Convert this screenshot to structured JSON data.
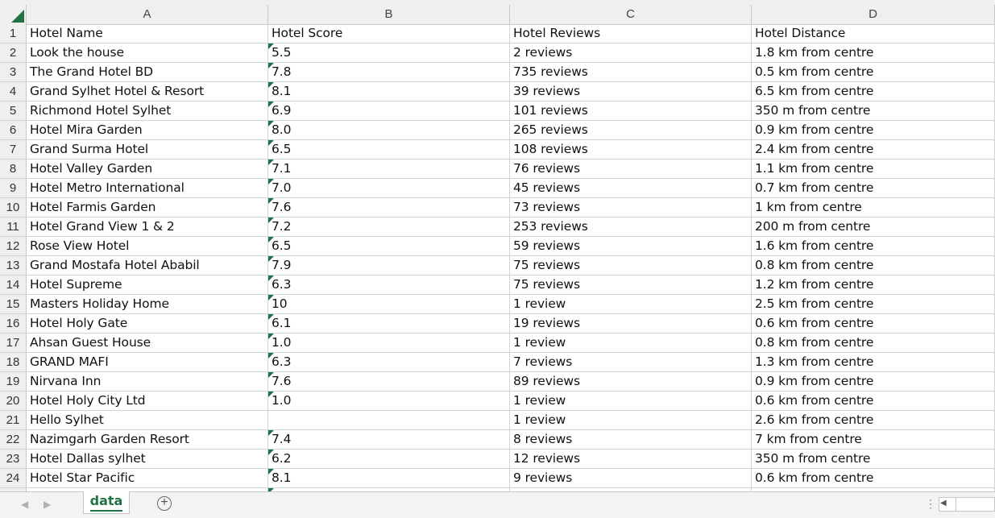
{
  "sheet": {
    "columns": [
      "A",
      "B",
      "C",
      "D"
    ],
    "rows": [
      {
        "n": "1",
        "a": "Hotel Name",
        "b": "Hotel Score",
        "c": "Hotel Reviews",
        "d": "Hotel Distance",
        "flag": false
      },
      {
        "n": "2",
        "a": "Look the house",
        "b": "5.5",
        "c": "2 reviews",
        "d": "1.8 km from centre",
        "flag": true
      },
      {
        "n": "3",
        "a": "The Grand Hotel BD",
        "b": "7.8",
        "c": "735 reviews",
        "d": "0.5 km from centre",
        "flag": true
      },
      {
        "n": "4",
        "a": "Grand Sylhet Hotel & Resort",
        "b": "8.1",
        "c": "39 reviews",
        "d": "6.5 km from centre",
        "flag": true
      },
      {
        "n": "5",
        "a": "Richmond Hotel Sylhet",
        "b": "6.9",
        "c": "101 reviews",
        "d": "350 m from centre",
        "flag": true
      },
      {
        "n": "6",
        "a": "Hotel Mira Garden",
        "b": "8.0",
        "c": "265 reviews",
        "d": "0.9 km from centre",
        "flag": true
      },
      {
        "n": "7",
        "a": "Grand Surma Hotel",
        "b": "6.5",
        "c": "108 reviews",
        "d": "2.4 km from centre",
        "flag": true
      },
      {
        "n": "8",
        "a": "Hotel Valley Garden",
        "b": "7.1",
        "c": "76 reviews",
        "d": "1.1 km from centre",
        "flag": true
      },
      {
        "n": "9",
        "a": "Hotel Metro International",
        "b": "7.0",
        "c": "45 reviews",
        "d": "0.7 km from centre",
        "flag": true
      },
      {
        "n": "10",
        "a": "Hotel Farmis Garden",
        "b": "7.6",
        "c": "73 reviews",
        "d": "1 km from centre",
        "flag": true
      },
      {
        "n": "11",
        "a": "Hotel Grand View 1 & 2",
        "b": "7.2",
        "c": "253 reviews",
        "d": "200 m from centre",
        "flag": true
      },
      {
        "n": "12",
        "a": "Rose View Hotel",
        "b": "6.5",
        "c": "59 reviews",
        "d": "1.6 km from centre",
        "flag": true
      },
      {
        "n": "13",
        "a": "Grand Mostafa Hotel Ababil",
        "b": "7.9",
        "c": "75 reviews",
        "d": "0.8 km from centre",
        "flag": true
      },
      {
        "n": "14",
        "a": "Hotel Supreme",
        "b": "6.3",
        "c": "75 reviews",
        "d": "1.2 km from centre",
        "flag": true
      },
      {
        "n": "15",
        "a": "Masters Holiday Home",
        "b": "10",
        "c": "1 review",
        "d": "2.5 km from centre",
        "flag": true
      },
      {
        "n": "16",
        "a": "Hotel Holy Gate",
        "b": "6.1",
        "c": "19 reviews",
        "d": "0.6 km from centre",
        "flag": true
      },
      {
        "n": "17",
        "a": "Ahsan Guest House",
        "b": "1.0",
        "c": "1 review",
        "d": "0.8 km from centre",
        "flag": true
      },
      {
        "n": "18",
        "a": "GRAND MAFI",
        "b": "6.3",
        "c": "7 reviews",
        "d": "1.3 km from centre",
        "flag": true
      },
      {
        "n": "19",
        "a": "Nirvana Inn",
        "b": "7.6",
        "c": "89 reviews",
        "d": "0.9 km from centre",
        "flag": true
      },
      {
        "n": "20",
        "a": "Hotel Holy City Ltd",
        "b": "1.0",
        "c": "1 review",
        "d": "0.6 km from centre",
        "flag": true
      },
      {
        "n": "21",
        "a": "Hello Sylhet",
        "b": "",
        "c": "1 review",
        "d": "2.6 km from centre",
        "flag": false
      },
      {
        "n": "22",
        "a": "Nazimgarh Garden Resort",
        "b": "7.4",
        "c": "8 reviews",
        "d": "7 km from centre",
        "flag": true
      },
      {
        "n": "23",
        "a": "Hotel Dallas sylhet",
        "b": "6.2",
        "c": "12 reviews",
        "d": "350 m from centre",
        "flag": true
      },
      {
        "n": "24",
        "a": "Hotel Star Pacific",
        "b": "8.1",
        "c": "9 reviews",
        "d": "0.6 km from centre",
        "flag": true
      }
    ]
  },
  "footer": {
    "prev_icon": "◀",
    "next_icon": "▶",
    "sheet_tab_label": "data",
    "add_sheet_icon": "+",
    "more_icon": "⋮",
    "scroll_left_icon": "◀"
  },
  "colors": {
    "accent": "#217346",
    "error_flag": "#1e7145"
  }
}
